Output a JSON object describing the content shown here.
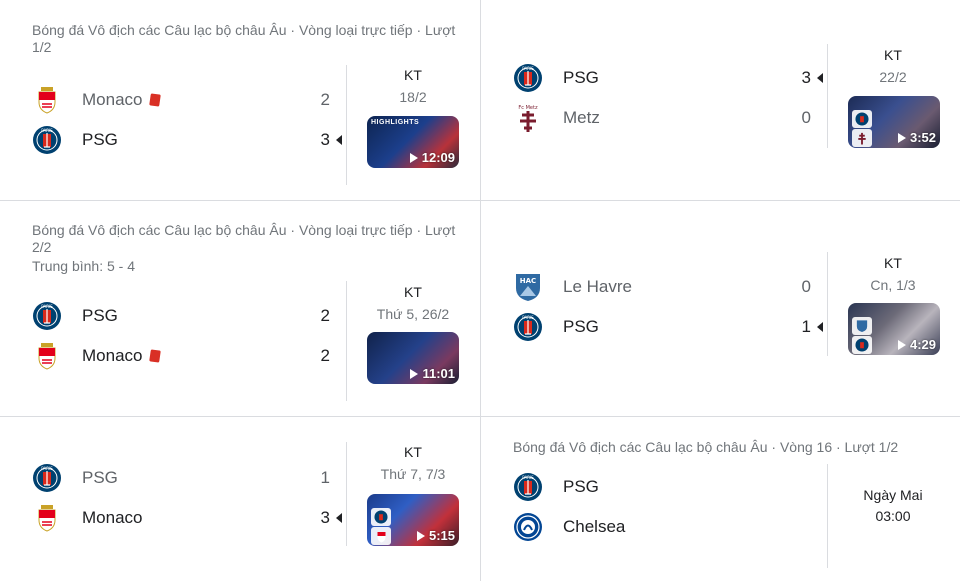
{
  "matches": [
    {
      "header": "Bóng đá Vô địch các Câu lạc bộ châu Âu · Vòng loại trực tiếp · Lượt 1/2",
      "teams": [
        {
          "name": "Monaco",
          "score": "2",
          "logo": "monaco-crest",
          "red_card": true,
          "winner": false
        },
        {
          "name": "PSG",
          "score": "3",
          "logo": "psg-crest",
          "red_card": false,
          "winner": true
        }
      ],
      "status": "KT",
      "date": "18/2",
      "video_duration": "12:09",
      "video_label": "HIGHLIGHTS"
    },
    {
      "header": "",
      "teams": [
        {
          "name": "PSG",
          "score": "3",
          "logo": "psg-crest",
          "red_card": false,
          "winner": true
        },
        {
          "name": "Metz",
          "score": "0",
          "logo": "metz-crest",
          "red_card": false,
          "winner": false
        }
      ],
      "status": "KT",
      "date": "22/2",
      "video_duration": "3:52"
    },
    {
      "header": "Bóng đá Vô địch các Câu lạc bộ châu Âu · Vòng loại trực tiếp · Lượt 2/2",
      "aggregate": "Trung bình: 5 - 4",
      "teams": [
        {
          "name": "PSG",
          "score": "2",
          "logo": "psg-crest",
          "red_card": false,
          "winner": false
        },
        {
          "name": "Monaco",
          "score": "2",
          "logo": "monaco-crest",
          "red_card": true,
          "winner": false
        }
      ],
      "status": "KT",
      "date": "Thứ 5, 26/2",
      "video_duration": "11:01"
    },
    {
      "header": "",
      "teams": [
        {
          "name": "Le Havre",
          "score": "0",
          "logo": "le-havre-crest",
          "red_card": false,
          "winner": false
        },
        {
          "name": "PSG",
          "score": "1",
          "logo": "psg-crest",
          "red_card": false,
          "winner": true
        }
      ],
      "status": "KT",
      "date": "Cn, 1/3",
      "video_duration": "4:29"
    },
    {
      "header": "",
      "teams": [
        {
          "name": "PSG",
          "score": "1",
          "logo": "psg-crest",
          "red_card": false,
          "winner": false
        },
        {
          "name": "Monaco",
          "score": "3",
          "logo": "monaco-crest",
          "red_card": false,
          "winner": true
        }
      ],
      "status": "KT",
      "date": "Thứ 7, 7/3",
      "video_duration": "5:15"
    },
    {
      "header": "Bóng đá Vô địch các Câu lạc bộ châu Âu · Vòng 16 · Lượt 1/2",
      "teams": [
        {
          "name": "PSG",
          "logo": "psg-crest"
        },
        {
          "name": "Chelsea",
          "logo": "chelsea-crest"
        }
      ],
      "upcoming_day": "Ngày Mai",
      "upcoming_time": "03:00"
    }
  ],
  "colors": {
    "psg_navy": "#004170",
    "psg_red": "#da291c",
    "monaco_red": "#e3001b",
    "metz_maroon": "#7a1c2e",
    "le_havre_blue": "#2f6aa3",
    "chelsea_blue": "#034694",
    "red_card": "#d93025",
    "divider": "#dadce0"
  }
}
